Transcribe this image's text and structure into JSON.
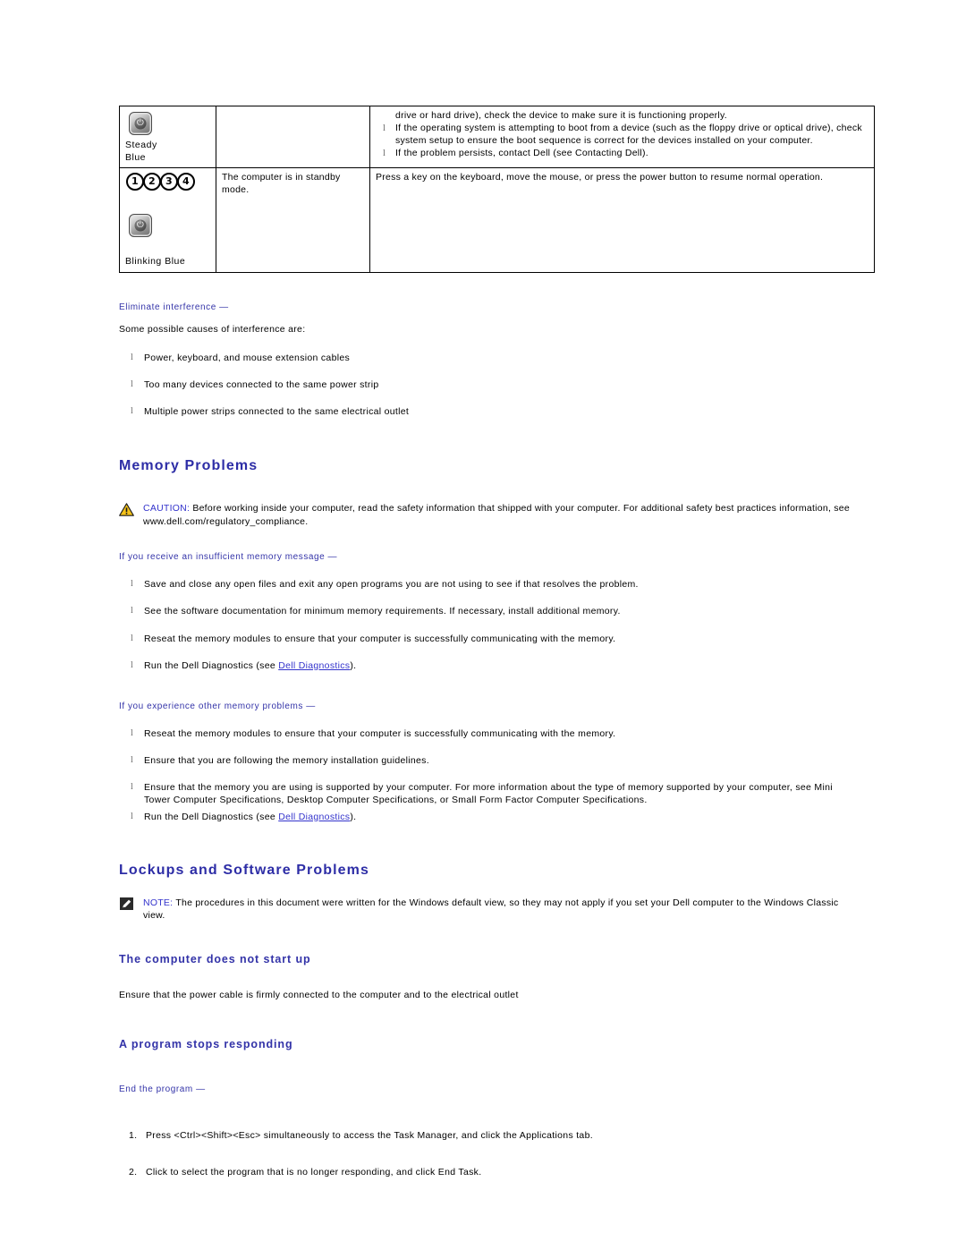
{
  "table": {
    "rows": [
      {
        "light_icon": "power-button-icon",
        "light_label": "Steady\nBlue",
        "description": "",
        "action_lead": "drive or hard drive), check the device to make sure it is functioning properly.",
        "action_items": [
          "If the operating system is attempting to boot from a device (such as the floppy drive or optical drive), check system setup to ensure the boot sequence is correct for the devices installed on your computer.",
          "If the problem persists, contact Dell (see Contacting Dell)."
        ]
      },
      {
        "light_icon": "numbered-diagnostic-lights-icon",
        "numbers": [
          "1",
          "2",
          "3",
          "4"
        ],
        "light_label": "Blinking Blue",
        "description": "The computer is in standby mode.",
        "action_lead": "Press a key on the keyboard, move the mouse, or press the power button to resume normal operation.",
        "action_items": []
      }
    ]
  },
  "interference": {
    "heading": "Eliminate interference —",
    "intro": "Some possible causes of interference are:",
    "items": [
      "Power, keyboard, and mouse extension cables",
      "Too many devices connected to the same power strip",
      "Multiple power strips connected to the same electrical outlet"
    ]
  },
  "memory": {
    "section_title": "Memory Problems",
    "caution": {
      "label": "CAUTION:",
      "text": "Before working inside your computer, read the safety information that shipped with your computer. For additional safety best practices information, see www.dell.com/regulatory_compliance."
    },
    "group_one": {
      "heading": "If you receive an insufficient memory message —",
      "items": [
        "Save and close any open files and exit any open programs you are not using to see if that resolves the problem.",
        "See the software documentation for minimum memory requirements. If necessary, install additional memory.",
        "Reseat the memory modules to ensure that your computer is successfully communicating with the memory."
      ],
      "last_item_prefix": "Run the Dell Diagnostics (see ",
      "last_item_link": "Dell Diagnostics",
      "last_item_suffix": ")."
    },
    "group_two": {
      "heading": "If you experience other memory problems —",
      "items": [
        "Reseat the memory modules to ensure that your computer is successfully communicating with the memory.",
        "Ensure that you are following the memory installation guidelines.",
        "Ensure that the memory you are using is supported by your computer. For more information about the type of memory supported by your computer, see Mini Tower Computer Specifications, Desktop Computer Specifications, or Small Form Factor Computer Specifications."
      ],
      "last_item_prefix": "Run the Dell Diagnostics (see ",
      "last_item_link": "Dell Diagnostics",
      "last_item_suffix": ")."
    }
  },
  "lockups": {
    "section_title": "Lockups and Software Problems",
    "note": {
      "label": "NOTE:",
      "text": "The procedures in this document were written for the Windows default view, so they may not apply if you set your Dell computer to the Windows Classic view."
    },
    "sub_one": {
      "heading": "The computer does not start up",
      "text": "Ensure that the power cable is firmly connected to the computer and to the electrical outlet"
    },
    "sub_two": {
      "heading": "A program stops responding",
      "sub_blue": "End the program —",
      "steps": [
        "Press <Ctrl><Shift><Esc> simultaneously to access the Task Manager, and click the Applications tab.",
        "Click to select the program that is no longer responding, and click End Task."
      ]
    }
  },
  "colors": {
    "heading_blue": "#2d2da6",
    "link_blue": "#3333cc",
    "caution_yellow": "#f4c21a"
  }
}
